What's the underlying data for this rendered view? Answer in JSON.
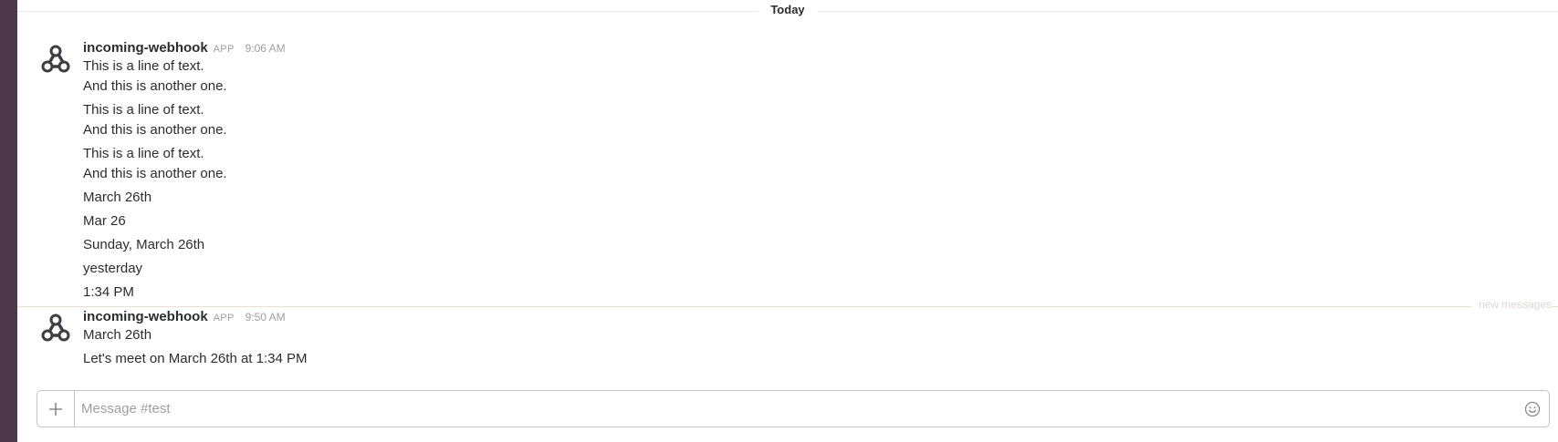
{
  "day_divider": {
    "label": "Today"
  },
  "messages": [
    {
      "sender": "incoming-webhook",
      "app_tag": "APP",
      "time": "9:06 AM",
      "lines": [
        "This is a line of text.",
        "And this is another one.",
        "This is a line of text.",
        "And this is another one.",
        "This is a line of text.",
        "And this is another one.",
        "March 26th",
        "Mar 26",
        "Sunday, March 26th",
        "yesterday",
        "1:34 PM"
      ]
    },
    {
      "sender": "incoming-webhook",
      "app_tag": "APP",
      "time": "9:50 AM",
      "lines": [
        "March 26th",
        "Let's meet on March 26th at 1:34 PM"
      ]
    }
  ],
  "new_messages": {
    "label": "new messages"
  },
  "composer": {
    "placeholder": "Message #test"
  },
  "icons": {
    "avatar": "webhook-icon",
    "add": "plus-icon",
    "emoji": "smiley-icon"
  },
  "colors": {
    "sidebar": "#4d394b",
    "text": "#2c2d30",
    "muted": "#a0a0a2",
    "new_messages": "#e0d5d3"
  }
}
